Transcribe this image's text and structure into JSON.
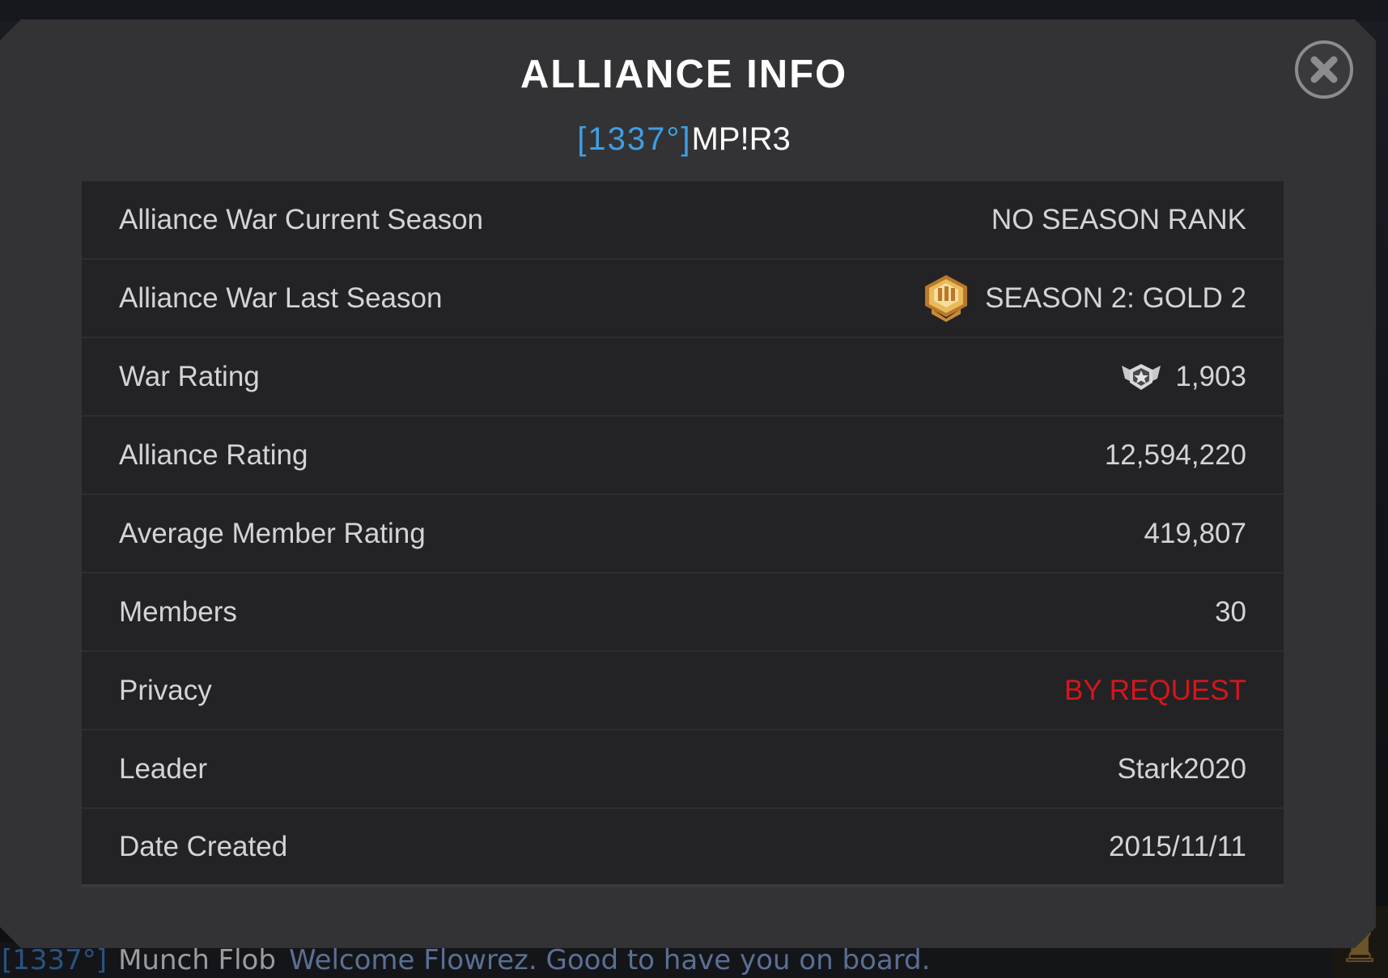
{
  "dialog": {
    "title": "ALLIANCE INFO",
    "alliance_tag": "[1337°]",
    "alliance_name": "MP!R3"
  },
  "rows": [
    {
      "label": "Alliance War Current Season",
      "value": "NO SEASON RANK"
    },
    {
      "label": "Alliance War Last Season",
      "value": "SEASON 2: GOLD 2",
      "icon": "gold-tier-badge-icon"
    },
    {
      "label": "War Rating",
      "value": "1,903",
      "icon": "war-rating-emblem-icon"
    },
    {
      "label": "Alliance Rating",
      "value": "12,594,220"
    },
    {
      "label": "Average Member Rating",
      "value": "419,807"
    },
    {
      "label": "Members",
      "value": "30"
    },
    {
      "label": "Privacy",
      "value": "BY REQUEST",
      "value_color": "#d6161b"
    },
    {
      "label": "Leader",
      "value": "Stark2020"
    },
    {
      "label": "Date Created",
      "value": "2015/11/11"
    }
  ],
  "chat": {
    "tag": "[1337°]",
    "sender": "Munch Flob",
    "message": "Welcome Flowrez. Good to have you on board."
  },
  "colors": {
    "tag_blue": "#3d9fe6",
    "privacy_red": "#d6161b",
    "panel": "#333335",
    "table": "#232325"
  }
}
